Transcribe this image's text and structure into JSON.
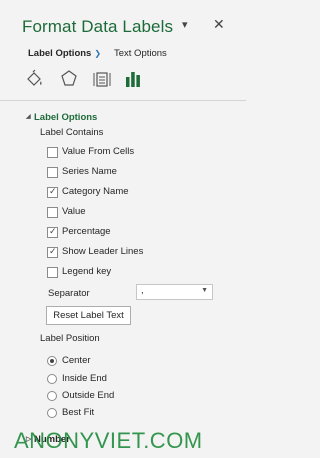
{
  "header": {
    "title": "Format Data Labels",
    "dropdown_glyph": "▾",
    "close_glyph": "✕"
  },
  "tabs": [
    {
      "label": "Label Options",
      "active": true
    },
    {
      "label": "Text Options",
      "active": false
    }
  ],
  "category_icons": [
    "fill-line-icon",
    "effects-icon",
    "size-properties-icon",
    "label-options-icon"
  ],
  "accent_color": "#1e6b3a",
  "label_options": {
    "section_title": "Label Options",
    "label_contains_title": "Label Contains",
    "checkboxes": [
      {
        "label": "Value From Cells",
        "checked": false
      },
      {
        "label": "Series Name",
        "checked": false
      },
      {
        "label": "Category Name",
        "checked": true
      },
      {
        "label": "Value",
        "checked": false
      },
      {
        "label": "Percentage",
        "checked": true
      },
      {
        "label": "Show Leader Lines",
        "checked": true
      },
      {
        "label": "Legend key",
        "checked": false
      }
    ],
    "separator_label": "Separator",
    "separator_value": ",",
    "reset_button": "Reset Label Text",
    "label_position_title": "Label Position",
    "positions": [
      {
        "label": "Center",
        "selected": true
      },
      {
        "label": "Inside End",
        "selected": false
      },
      {
        "label": "Outside End",
        "selected": false
      },
      {
        "label": "Best Fit",
        "selected": false
      }
    ]
  },
  "number_section": {
    "title": "Number"
  },
  "watermark": "ANONYVIET.COM"
}
